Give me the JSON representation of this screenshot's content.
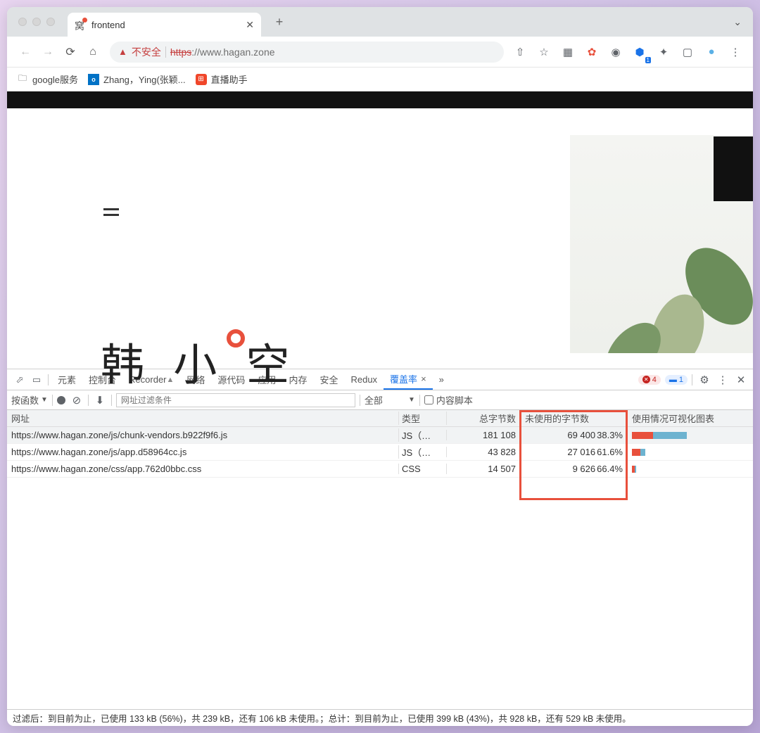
{
  "tab": {
    "title": "frontend"
  },
  "address": {
    "insecure": "不安全",
    "url_scheme_strike": "https",
    "url_rest": "://www.hagan.zone"
  },
  "bookmarks": {
    "item1": "google服务",
    "item2": "Zhang，Ying(张颖...",
    "item3": "直播助手"
  },
  "page_content": {
    "headline": "韩 小 空"
  },
  "devtools": {
    "tabs": {
      "elements": "元素",
      "console": "控制台",
      "recorder": "Recorder",
      "network": "网络",
      "sources": "源代码",
      "application": "应用",
      "memory": "内存",
      "security": "安全",
      "redux": "Redux",
      "coverage": "覆盖率"
    },
    "badges": {
      "err": "4",
      "info": "1"
    },
    "toolbar": {
      "by_function": "按函数",
      "filter_placeholder": "网址过滤条件",
      "scope": "全部",
      "content_scripts": "内容脚本"
    },
    "columns": {
      "url": "网址",
      "type": "类型",
      "total": "总字节数",
      "unused": "未使用的字节数",
      "vis": "使用情况可视化图表"
    },
    "rows": [
      {
        "url": "https://www.hagan.zone/js/chunk-vendors.b922f9f6.js",
        "type": "JS（…",
        "total": "181 108",
        "unused": "69 400",
        "pct": "38.3%",
        "barR": 30,
        "barB": 48
      },
      {
        "url": "https://www.hagan.zone/js/app.d58964cc.js",
        "type": "JS（…",
        "total": "43 828",
        "unused": "27 016",
        "pct": "61.6%",
        "barR": 12,
        "barB": 7
      },
      {
        "url": "https://www.hagan.zone/css/app.762d0bbc.css",
        "type": "CSS",
        "total": "14 507",
        "unused": "9 626",
        "pct": "66.4%",
        "barR": 4,
        "barB": 2
      }
    ],
    "footer": "过滤后：到目前为止，已使用 133 kB (56%)，共 239 kB，还有 106 kB 未使用。；总计：到目前为止，已使用 399 kB (43%)，共 928 kB，还有 529 kB 未使用。"
  }
}
